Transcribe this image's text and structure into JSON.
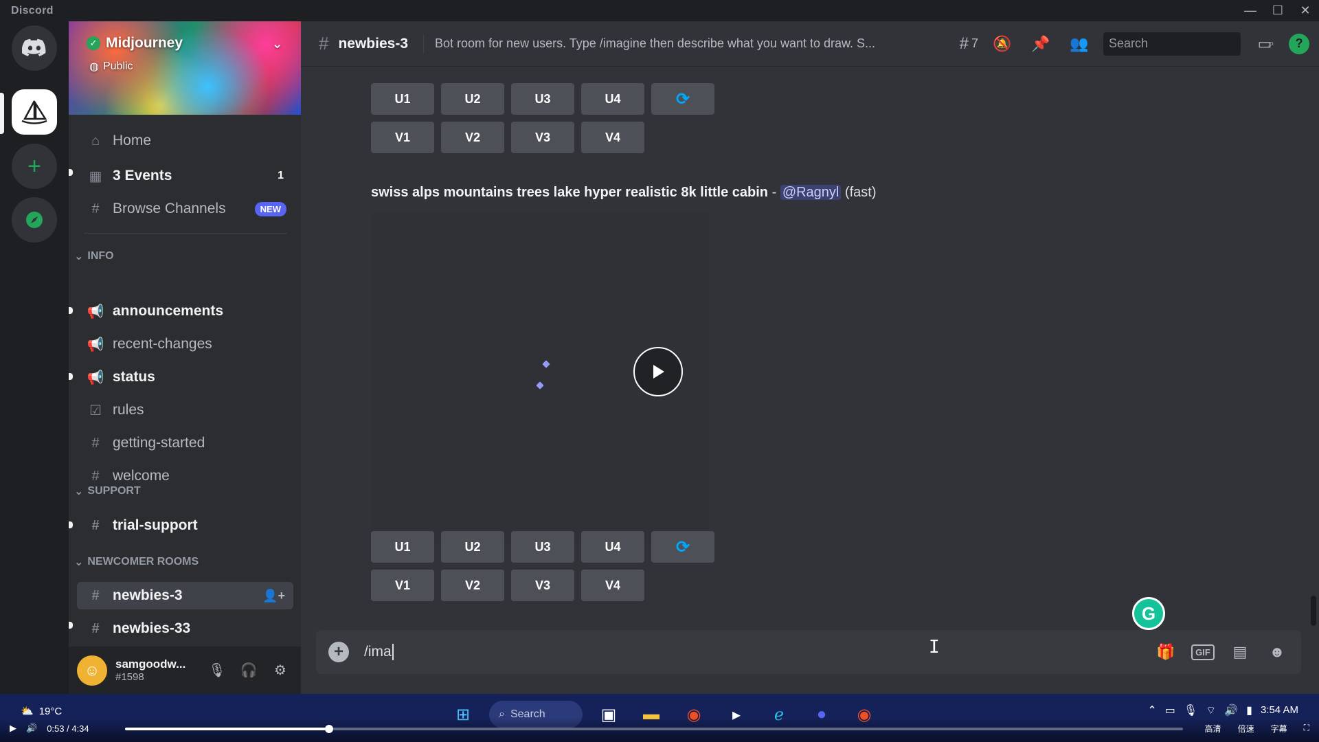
{
  "app": {
    "title": "Discord"
  },
  "window": {
    "minimize": "—",
    "maximize": "☐",
    "close": "✕"
  },
  "rail": {
    "home_icon": "discord-logo-icon",
    "server_icon": "sailboat-icon",
    "add_icon": "plus-icon",
    "explore_icon": "compass-icon"
  },
  "guild": {
    "name": "Midjourney",
    "visibility": "Public"
  },
  "sidebar": {
    "home": "Home",
    "events": "3 Events",
    "events_count": "1",
    "browse": "Browse Channels",
    "browse_badge": "NEW",
    "cat_info": "INFO",
    "ch_announcements": "announcements",
    "ch_recent": "recent-changes",
    "ch_status": "status",
    "ch_rules": "rules",
    "ch_getting_started": "getting-started",
    "ch_welcome": "welcome",
    "cat_support": "SUPPORT",
    "ch_trial_support": "trial-support",
    "cat_newcomer": "NEWCOMER ROOMS",
    "ch_newbies3": "newbies-3",
    "ch_newbies33": "newbies-33"
  },
  "user": {
    "name": "samgoodw...",
    "discriminator": "#1598"
  },
  "header": {
    "channel": "newbies-3",
    "topic": "Bot room for new users. Type /imagine then describe what you want to draw. S...",
    "threads_count": "7",
    "search_placeholder": "Search",
    "help": "?"
  },
  "buttons": {
    "u1": "U1",
    "u2": "U2",
    "u3": "U3",
    "u4": "U4",
    "v1": "V1",
    "v2": "V2",
    "v3": "V3",
    "v4": "V4"
  },
  "message": {
    "prompt": "swiss alps mountains trees lake hyper realistic 8k little cabin",
    "dash": " - ",
    "mention": "@Ragnyl",
    "speed": " (fast)"
  },
  "composer": {
    "typed": "/ima",
    "gif": "GIF"
  },
  "grammarly": "G",
  "taskbar": {
    "temperature": "19°C",
    "search": "Search",
    "time": "3:54 AM",
    "ime_1": "高清",
    "ime_2": "倍速",
    "ime_3": "字幕"
  },
  "video": {
    "current": "0:53",
    "separator": " / ",
    "duration": "4:34",
    "progress": 0.193
  },
  "colors": {
    "accent": "#5865f2",
    "online": "#23a55a",
    "background": "#313338",
    "sidebar": "#2b2d31"
  }
}
